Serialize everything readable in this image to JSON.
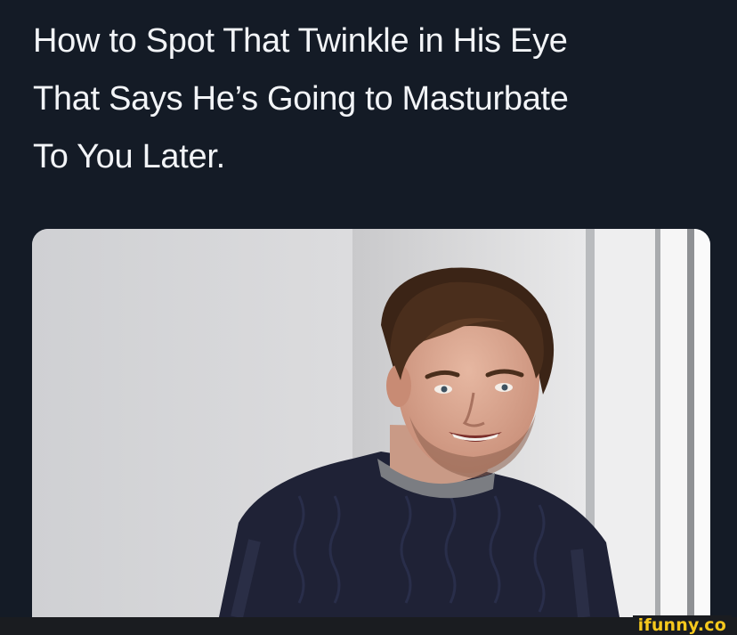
{
  "post": {
    "title_lines": [
      "How to Spot That Twinkle in His Eye",
      "That Says He’s Going to Masturbate",
      "To You Later."
    ]
  },
  "watermark": {
    "text": "ifunny.co",
    "color": "#f6c81d"
  },
  "colors": {
    "background": "#141b26",
    "text": "#f2f4f7"
  }
}
